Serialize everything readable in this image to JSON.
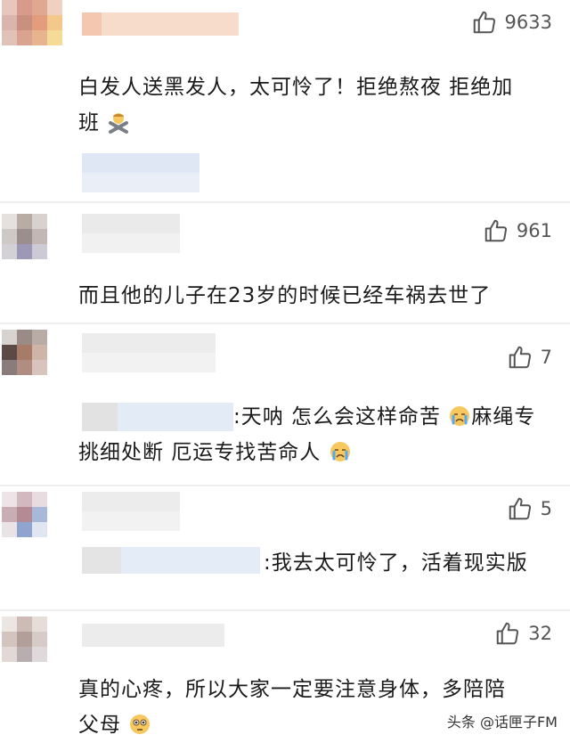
{
  "comments": [
    {
      "likes": "9633",
      "text_line1": "白发人送黑发人，太可怜了！拒绝熬夜 拒绝加",
      "text_line2": "班"
    },
    {
      "likes": "961",
      "text": "而且他的儿子在23岁的时候已经车祸去世了"
    },
    {
      "likes": "7",
      "text_line1": ":天呐 怎么会这样命苦",
      "text_line1b": "麻绳专",
      "text_line2": "挑细处断 厄运专找苦命人"
    },
    {
      "likes": "5",
      "text": ":我去太可怜了，活着现实版"
    },
    {
      "likes": "32",
      "text_line1": "真的心疼，所以大家一定要注意身体，多陪陪",
      "text_line2": "父母"
    }
  ],
  "icons": {
    "like": "thumbs-up-icon",
    "cross_emoji": "person-gesturing-no-icon",
    "cry_emoji": "crying-face-icon",
    "plead_emoji": "pleading-face-icon"
  },
  "watermark": "头条 @话匣子FM",
  "colors": {
    "background": "#ffffff",
    "divider": "#eceef0",
    "text": "#1a1a1a",
    "icon": "#555555"
  }
}
